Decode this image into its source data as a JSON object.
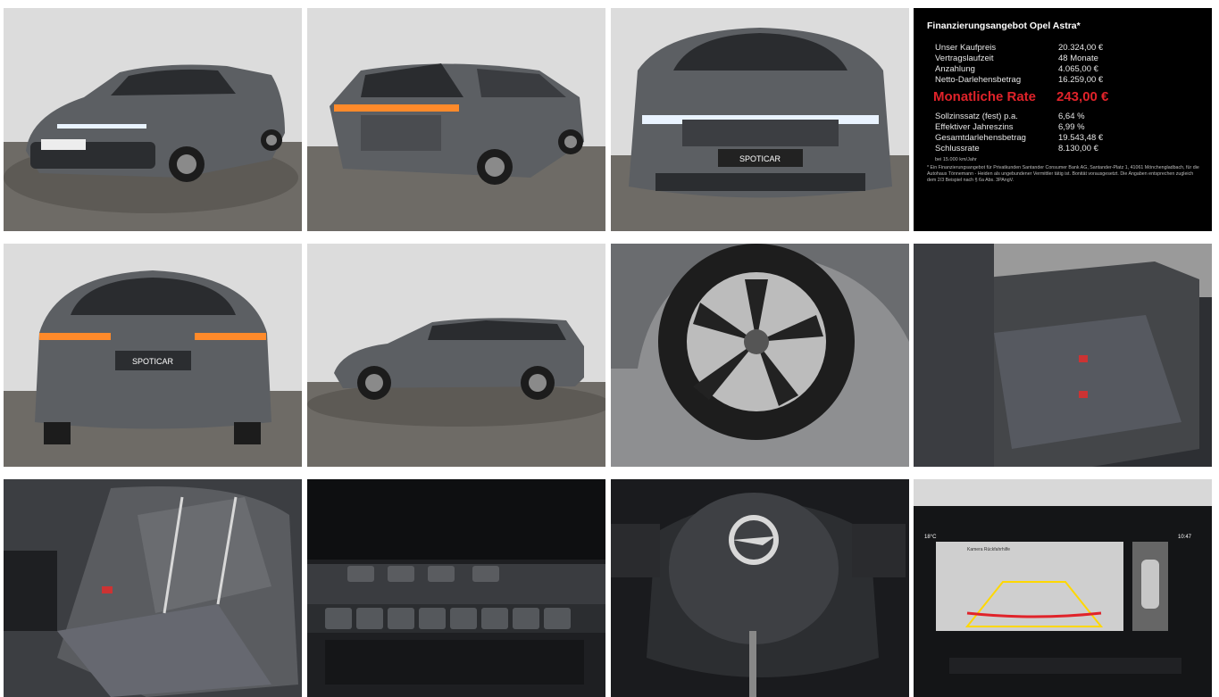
{
  "gallery": {
    "images": [
      {
        "name": "front-three-quarter-photo"
      },
      {
        "name": "rear-three-quarter-photo"
      },
      {
        "name": "front-view-photo"
      },
      {
        "name": "finance-offer-panel"
      },
      {
        "name": "rear-view-photo"
      },
      {
        "name": "side-profile-photo"
      },
      {
        "name": "alloy-wheel-photo"
      },
      {
        "name": "rear-seats-photo"
      },
      {
        "name": "front-seat-photo"
      },
      {
        "name": "climate-controls-photo"
      },
      {
        "name": "steering-wheel-photo"
      },
      {
        "name": "rear-camera-display-photo"
      }
    ],
    "dealer_plate_text": "SPOTICAR",
    "car_color": "#5c5f63"
  },
  "finance": {
    "title": "Finanzierungsangebot Opel Astra*",
    "rows": [
      {
        "label": "Unser Kaufpreis",
        "value": "20.324,00 €"
      },
      {
        "label": "Vertragslaufzeit",
        "value": "48 Monate"
      },
      {
        "label": "Anzahlung",
        "value": "4.065,00 €"
      },
      {
        "label": "Netto-Darlehensbetrag",
        "value": "16.259,00 €"
      }
    ],
    "monthly_label": "Monatliche Rate",
    "monthly_value": "243,00 €",
    "rows2": [
      {
        "label": "Sollzinssatz (fest) p.a.",
        "value": "6,64 %"
      },
      {
        "label": "Effektiver Jahreszins",
        "value": "6,99 %"
      },
      {
        "label": "Gesamtdarlehensbetrag",
        "value": "19.543,48 €"
      },
      {
        "label": "Schlussrate",
        "value": "8.130,00 €"
      }
    ],
    "km_note": "bei 15.000 km/Jahr",
    "footnote": "* Ein Finanzierungsangebot für Privatkunden Santander Consumer Bank AG, Santander-Platz 1, 41061 Mönchengladbach, für die Autohaus Tönnemann - Heiden als ungebundener Vermittler tätig ist. Bonität vorausgesetzt. Die Angaben entsprechen zugleich dem 2/3 Beispiel nach § 6a Abs. 3PAngV.",
    "accent_color": "#e0232a"
  },
  "camera_display": {
    "temp": "18°C",
    "time": "10:47",
    "caption": "Kamera Rückfahrhilfe"
  }
}
